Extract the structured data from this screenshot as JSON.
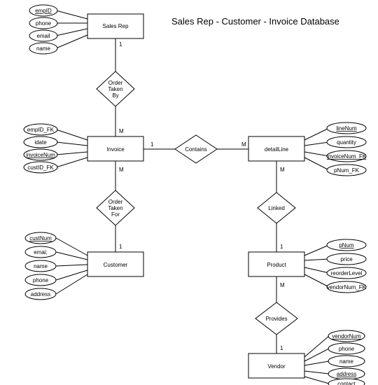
{
  "title": "Sales Rep - Customer - Invoice Database",
  "entities": {
    "salesRep": {
      "label": "Sales Rep"
    },
    "invoice": {
      "label": "Invoice"
    },
    "detailLine": {
      "label": "detailLine"
    },
    "customer": {
      "label": "Customer"
    },
    "product": {
      "label": "Product"
    },
    "vendor": {
      "label": "Vendor"
    }
  },
  "relationships": {
    "orderTakenBy": {
      "line1": "Order",
      "line2": "Taken",
      "line3": "By"
    },
    "contains": {
      "label": "Contains"
    },
    "orderTakenFor": {
      "line1": "Order",
      "line2": "Taken",
      "line3": "For"
    },
    "linked": {
      "label": "Linked"
    },
    "provides": {
      "label": "Provides"
    }
  },
  "attributes": {
    "salesRep": [
      "empID",
      "phone",
      "email",
      "name"
    ],
    "invoice": [
      "empID_FK",
      "idate",
      "invoiceNum",
      "custID_FK"
    ],
    "detailLine": [
      "lineNum",
      "quantity",
      "invoiceNum_FK",
      "pNum_FK"
    ],
    "customer": [
      "custNum",
      "emai;",
      "name",
      "phone",
      "address"
    ],
    "product": [
      "pNum",
      "price",
      "reorderLevel",
      "vendorNum_FK"
    ],
    "vendor": [
      "vendorNum",
      "phone",
      "name",
      "address",
      "contact"
    ]
  },
  "primaryKeys": {
    "salesRep_empID": true,
    "invoice_invoiceNum": true,
    "detailLine_lineNum": true,
    "detailLine_invoiceNum_FK": true,
    "customer_custNum": true,
    "product_pNum": true,
    "vendor_vendorNum": true,
    "vendor_address": true
  },
  "cardinalities": {
    "salesRep_orderTakenBy": "1",
    "invoice_orderTakenBy": "M",
    "invoice_contains": "1",
    "detailLine_contains": "M",
    "invoice_orderTakenFor": "M",
    "customer_orderTakenFor": "1",
    "detailLine_linked": "M",
    "product_linked": "1",
    "product_provides": "M",
    "vendor_provides": "1"
  }
}
